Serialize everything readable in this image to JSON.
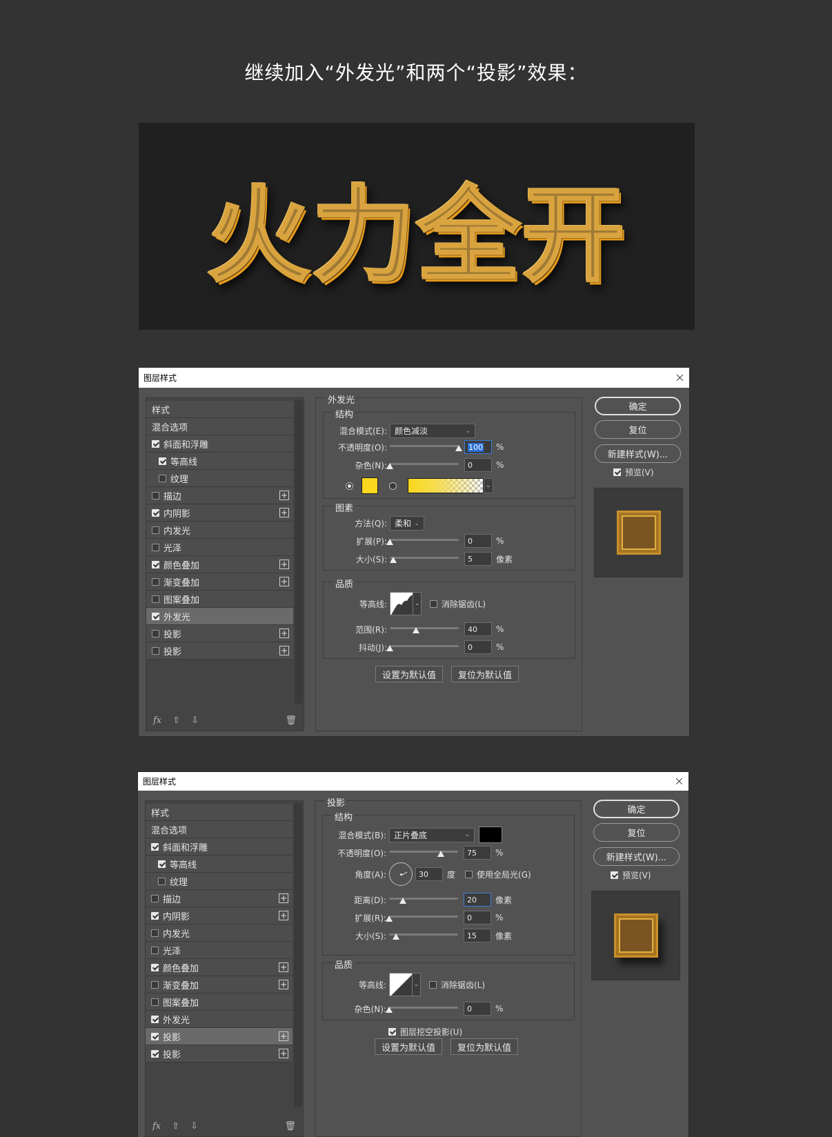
{
  "heading": "继续加入“外发光”和两个“投影”效果：",
  "artwork_text": "火力全开",
  "style_list": [
    {
      "label": "样式",
      "checkbox": false,
      "sub": false,
      "plus": false,
      "checked": false
    },
    {
      "label": "混合选项",
      "checkbox": false,
      "sub": false,
      "plus": false,
      "checked": false
    },
    {
      "label": "斜面和浮雕",
      "checkbox": true,
      "sub": false,
      "plus": false,
      "checked": true
    },
    {
      "label": "等高线",
      "checkbox": true,
      "sub": true,
      "plus": false,
      "checked": true
    },
    {
      "label": "纹理",
      "checkbox": true,
      "sub": true,
      "plus": false,
      "checked": false
    },
    {
      "label": "描边",
      "checkbox": true,
      "sub": false,
      "plus": true,
      "checked": false
    },
    {
      "label": "内阴影",
      "checkbox": true,
      "sub": false,
      "plus": true,
      "checked": true
    },
    {
      "label": "内发光",
      "checkbox": true,
      "sub": false,
      "plus": false,
      "checked": false
    },
    {
      "label": "光泽",
      "checkbox": true,
      "sub": false,
      "plus": false,
      "checked": false
    },
    {
      "label": "颜色叠加",
      "checkbox": true,
      "sub": false,
      "plus": true,
      "checked": true
    },
    {
      "label": "渐变叠加",
      "checkbox": true,
      "sub": false,
      "plus": true,
      "checked": false
    },
    {
      "label": "图案叠加",
      "checkbox": true,
      "sub": false,
      "plus": false,
      "checked": false
    },
    {
      "label": "外发光",
      "checkbox": true,
      "sub": false,
      "plus": false,
      "checked": true
    },
    {
      "label": "投影",
      "checkbox": true,
      "sub": false,
      "plus": true,
      "checked": false
    },
    {
      "label": "投影",
      "checkbox": true,
      "sub": false,
      "plus": true,
      "checked": false
    }
  ],
  "dialog1": {
    "title": "图层样式",
    "close": "×",
    "selected_index": 12,
    "panel_title": "外发光",
    "structure_title": "结构",
    "blend_label": "混合模式(E):",
    "blend_value": "颜色减淡",
    "opacity_label": "不透明度(O):",
    "opacity_value": "100",
    "opacity_pos": 1.0,
    "noise_label": "杂色(N):",
    "noise_value": "0",
    "noise_pos": 0,
    "elements_title": "图素",
    "method_label": "方法(Q):",
    "method_value": "柔和",
    "spread_label": "扩展(P):",
    "spread_value": "0",
    "spread_pos": 0,
    "size_label": "大小(S):",
    "size_value": "5",
    "size_pos": 0.05,
    "quality_title": "品质",
    "contour_label": "等高线:",
    "antialias_label": "消除锯齿(L)",
    "range_label": "范围(R):",
    "range_value": "40",
    "range_pos": 0.38,
    "jitter_label": "抖动(J):",
    "jitter_value": "0",
    "jitter_pos": 0,
    "set_default": "设置为默认值",
    "reset_default": "复位为默认值",
    "ok": "确定",
    "reset": "复位",
    "new_style": "新建样式(W)...",
    "preview": "预览(V)",
    "glow_color": "#f9d81d"
  },
  "dialog2": {
    "title": "图层样式",
    "close": "×",
    "selected_index": 13,
    "panel_title": "投影",
    "structure_title": "结构",
    "blend_label": "混合模式(B):",
    "blend_value": "正片叠底",
    "opacity_label": "不透明度(O):",
    "opacity_value": "75",
    "opacity_pos": 0.75,
    "angle_label": "角度(A):",
    "angle_value": "30",
    "angle_unit": "度",
    "global_light_label": "使用全局光(G)",
    "distance_label": "距离(D):",
    "distance_value": "20",
    "distance_pos": 0.2,
    "spread_label": "扩展(R):",
    "spread_value": "0",
    "spread_pos": 0,
    "size_label": "大小(S):",
    "size_value": "15",
    "size_pos": 0.1,
    "quality_title": "品质",
    "contour_label": "等高线:",
    "antialias_label": "消除锯齿(L)",
    "noise_label": "杂色(N):",
    "noise_value": "0",
    "noise_pos": 0,
    "knockout_label": "图层挖空投影(U)",
    "set_default": "设置为默认值",
    "reset_default": "复位为默认值",
    "ok": "确定",
    "reset": "复位",
    "new_style": "新建样式(W)...",
    "preview": "预览(V)",
    "shadow_color": "#000000"
  },
  "dialog2_checked": [
    false,
    false,
    true,
    true,
    false,
    false,
    true,
    false,
    false,
    true,
    false,
    false,
    true,
    true,
    true
  ],
  "units": {
    "percent": "%",
    "pixels": "像素"
  },
  "icons": {
    "fx": "fx",
    "up": "up-arrow-icon",
    "down": "down-arrow-icon",
    "trash": "trash-icon"
  }
}
